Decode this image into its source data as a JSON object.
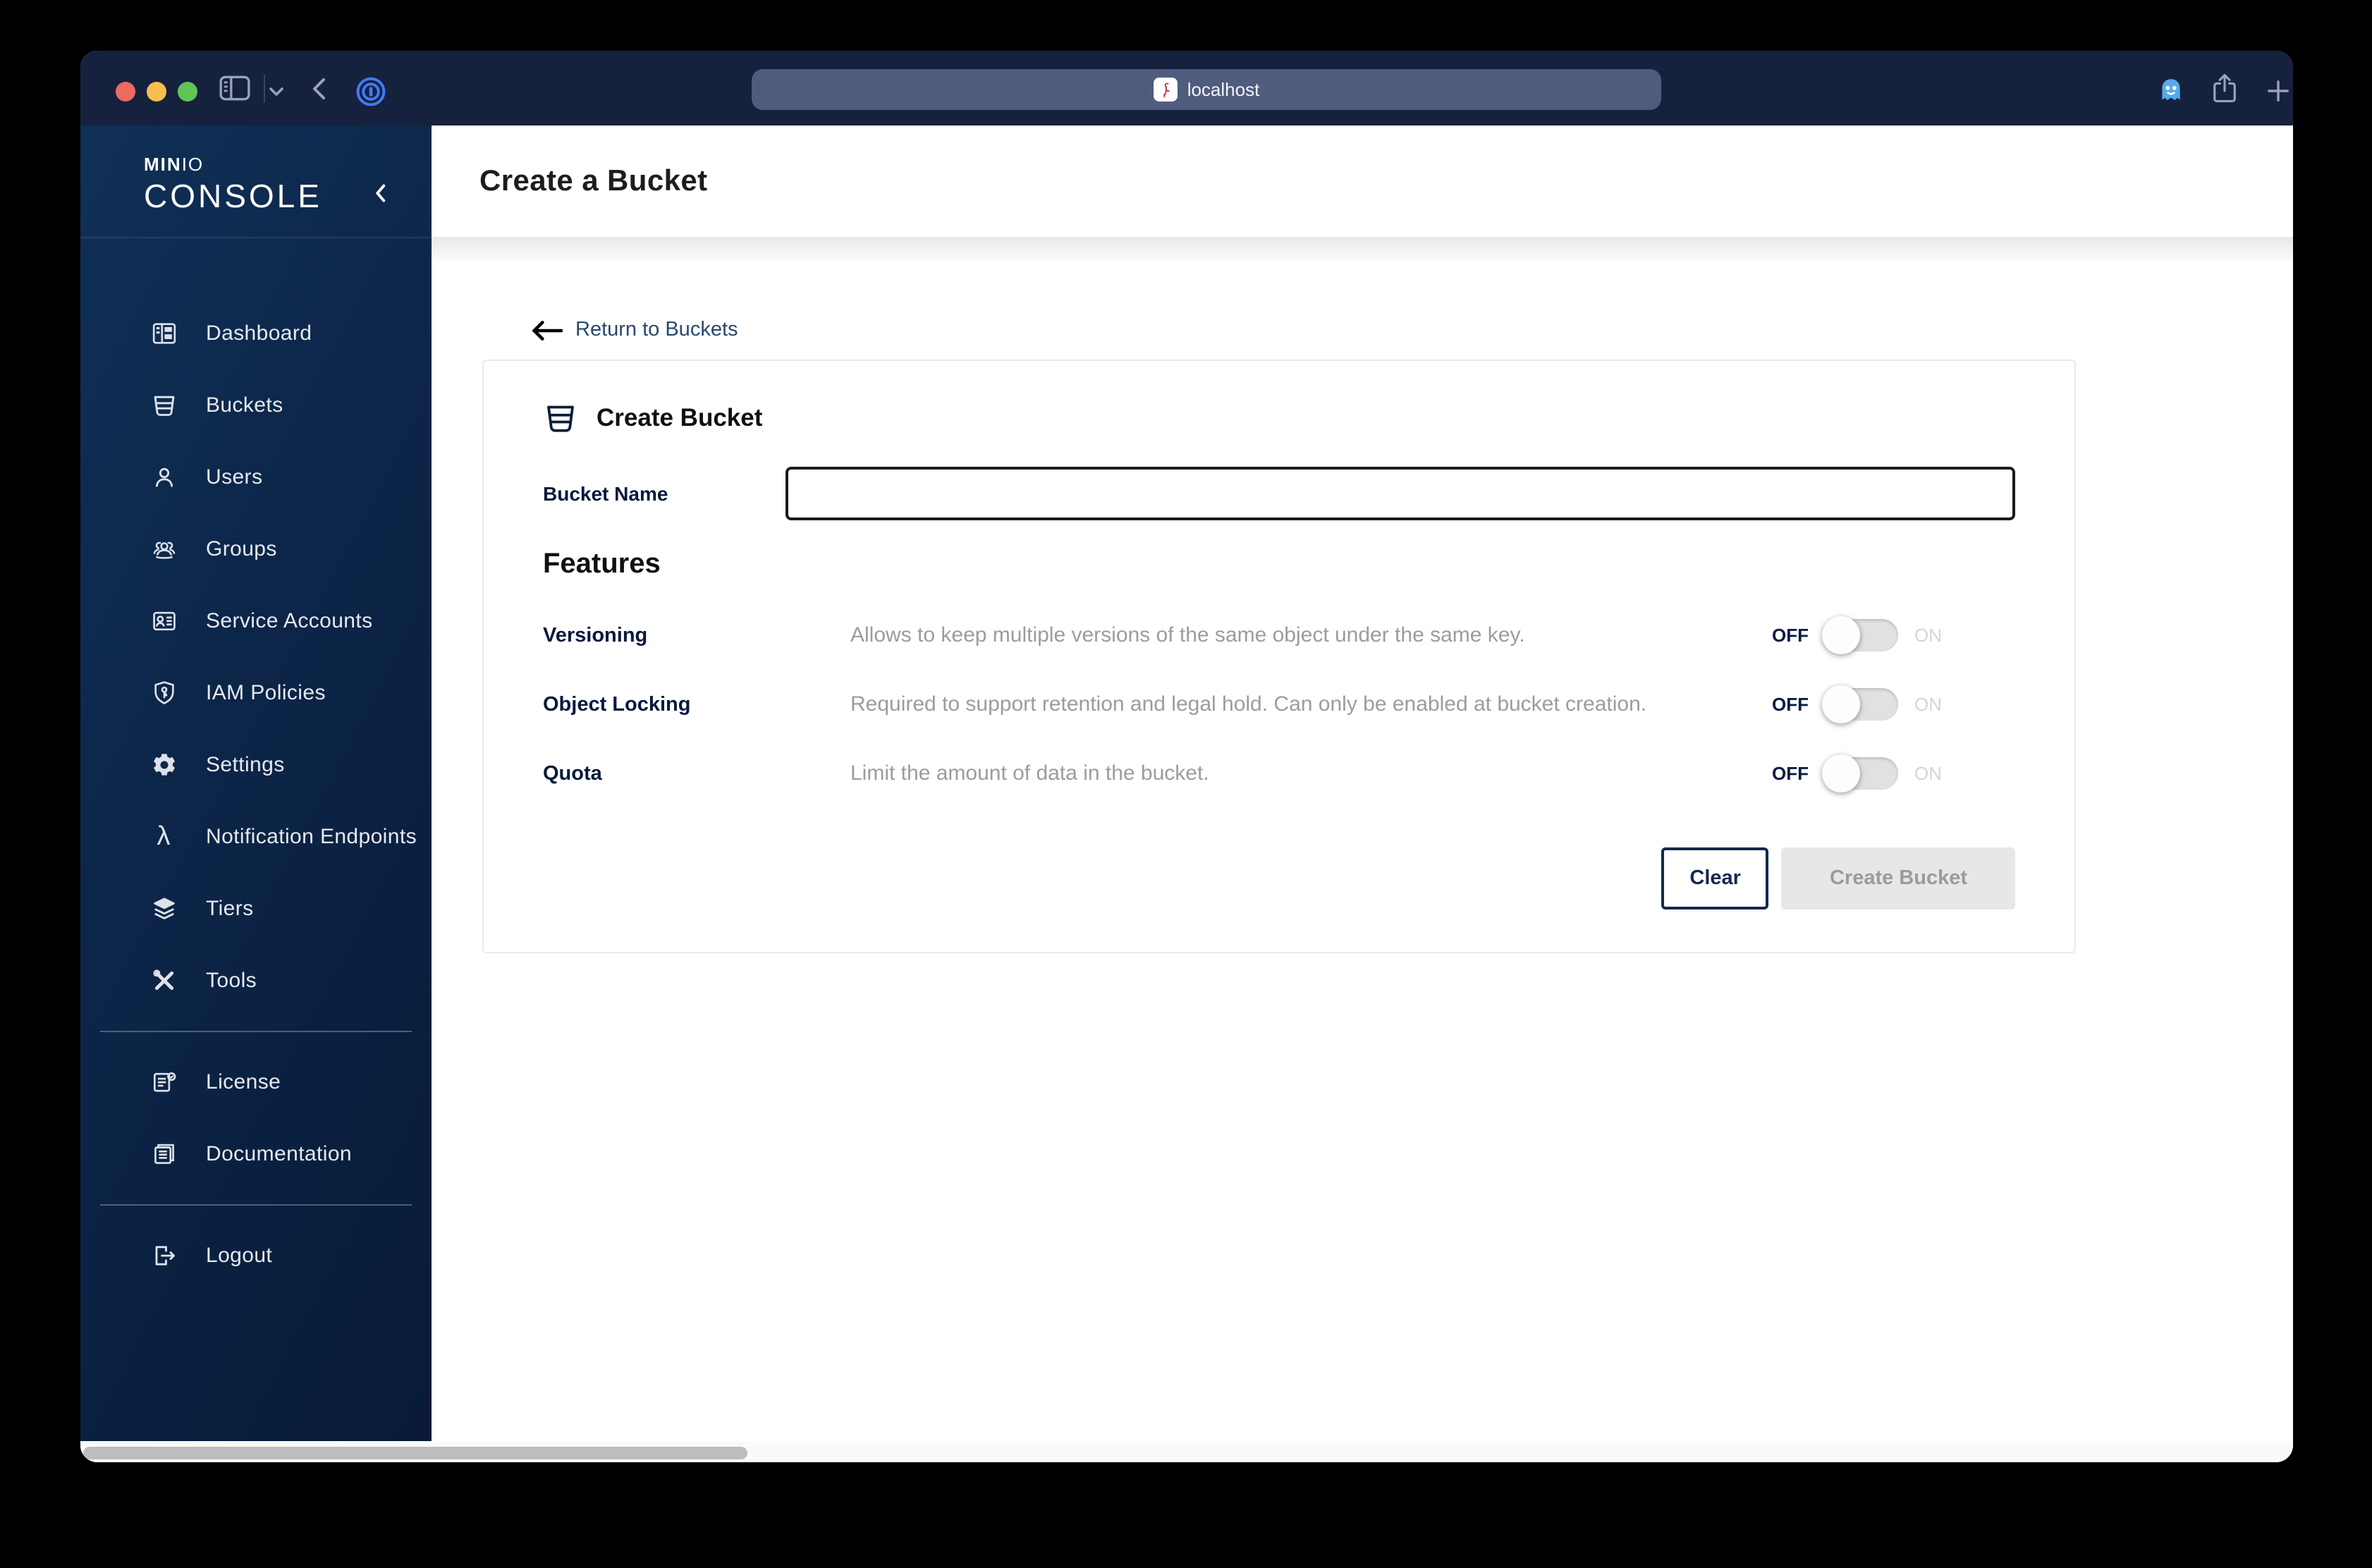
{
  "browser": {
    "address": {
      "host": "localhost",
      "favicon": "minio-flamingo-icon"
    },
    "left_icons": [
      "sidebar-toggle-icon",
      "tab-chevron-down-icon",
      "back-chevron-icon",
      "onepassword-icon"
    ],
    "right_icons": [
      "ghostery-icon",
      "share-icon",
      "new-tab-plus-icon"
    ]
  },
  "sidebar": {
    "logo": {
      "brand_bold": "MIN",
      "brand_light": "IO",
      "product": "CONSOLE"
    },
    "items": [
      {
        "label": "Dashboard",
        "icon": "dashboard-icon"
      },
      {
        "label": "Buckets",
        "icon": "bucket-icon"
      },
      {
        "label": "Users",
        "icon": "user-icon"
      },
      {
        "label": "Groups",
        "icon": "group-icon"
      },
      {
        "label": "Service Accounts",
        "icon": "id-card-icon"
      },
      {
        "label": "IAM Policies",
        "icon": "shield-key-icon"
      },
      {
        "label": "Settings",
        "icon": "gear-icon"
      },
      {
        "label": "Notification Endpoints",
        "icon": "lambda-icon"
      },
      {
        "label": "Tiers",
        "icon": "layers-icon"
      },
      {
        "label": "Tools",
        "icon": "tools-icon"
      },
      {
        "label": "License",
        "icon": "license-icon"
      },
      {
        "label": "Documentation",
        "icon": "documentation-icon"
      },
      {
        "label": "Logout",
        "icon": "logout-icon"
      }
    ]
  },
  "header": {
    "title": "Create a Bucket"
  },
  "page": {
    "back_link_label": "Return to Buckets",
    "card": {
      "title": "Create Bucket",
      "name_label": "Bucket Name",
      "name_value": "",
      "features_heading": "Features",
      "rows": [
        {
          "label": "Versioning",
          "description": "Allows to keep multiple versions of the same object under the same key.",
          "state": "OFF",
          "off_label": "OFF",
          "on_label": "ON"
        },
        {
          "label": "Object Locking",
          "description": "Required to support retention and legal hold. Can only be enabled at bucket creation.",
          "state": "OFF",
          "off_label": "OFF",
          "on_label": "ON"
        },
        {
          "label": "Quota",
          "description": "Limit the amount of data in the bucket.",
          "state": "OFF",
          "off_label": "OFF",
          "on_label": "ON"
        }
      ],
      "actions": {
        "clear_label": "Clear",
        "create_label": "Create Bucket",
        "create_disabled": true
      }
    }
  },
  "colors": {
    "titlebar": "#16213E",
    "address_bar": "#505C7E",
    "sidebar_gradient_start": "#103057",
    "sidebar_gradient_end": "#081A37",
    "accent_navy": "#07193C",
    "link_blue": "#27496F",
    "description_gray": "#9C9C9C",
    "toggle_track": "#E1E1E1",
    "disabled_button_bg": "#E7E7E7",
    "disabled_button_text": "#9B9B9B",
    "favicon_red": "#C72C48",
    "onepassword_blue": "#3F7BF6",
    "ghostery_blue": "#57ABEA"
  }
}
